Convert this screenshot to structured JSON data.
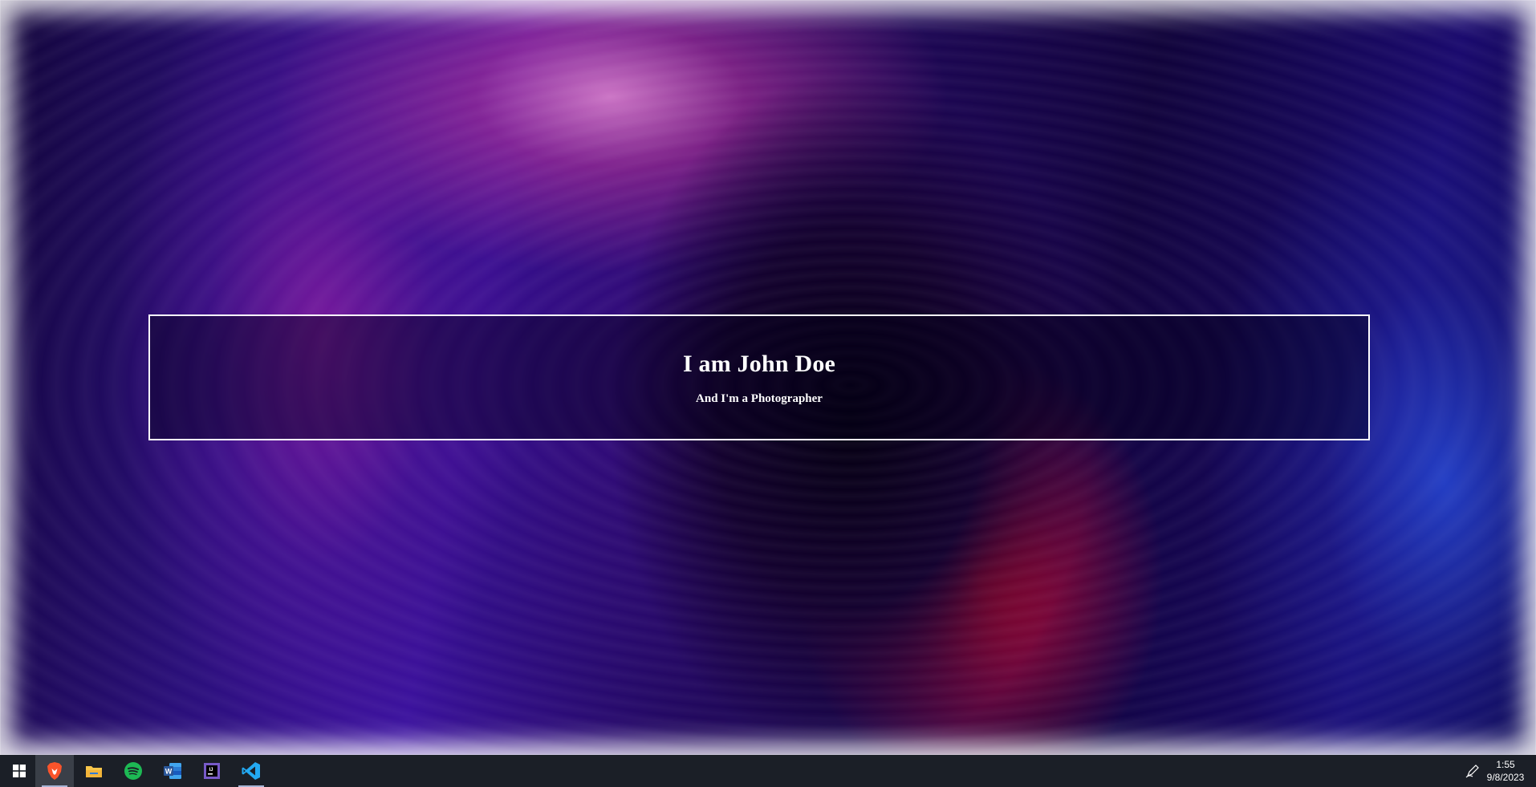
{
  "hero": {
    "title": "I am John Doe",
    "subtitle": "And I'm a Photographer"
  },
  "taskbar": {
    "apps": [
      {
        "name": "start",
        "icon": "windows-start-icon"
      },
      {
        "name": "brave",
        "icon": "brave-browser-icon",
        "active": true
      },
      {
        "name": "file-explorer",
        "icon": "folder-icon"
      },
      {
        "name": "spotify",
        "icon": "spotify-icon"
      },
      {
        "name": "word",
        "icon": "word-icon"
      },
      {
        "name": "intellij",
        "icon": "intellij-icon"
      },
      {
        "name": "vscode",
        "icon": "vscode-icon",
        "running": true
      }
    ],
    "tray_icon": "pen-icon",
    "time": "1:55",
    "date": "9/8/2023"
  },
  "colors": {
    "taskbar_bg": "#1b1f27",
    "hero_border": "#ffffff",
    "brave": "#fb542b",
    "spotify": "#1db954",
    "word": "#2b579a",
    "vscode": "#23a9f2",
    "folder": "#f8c64a"
  }
}
